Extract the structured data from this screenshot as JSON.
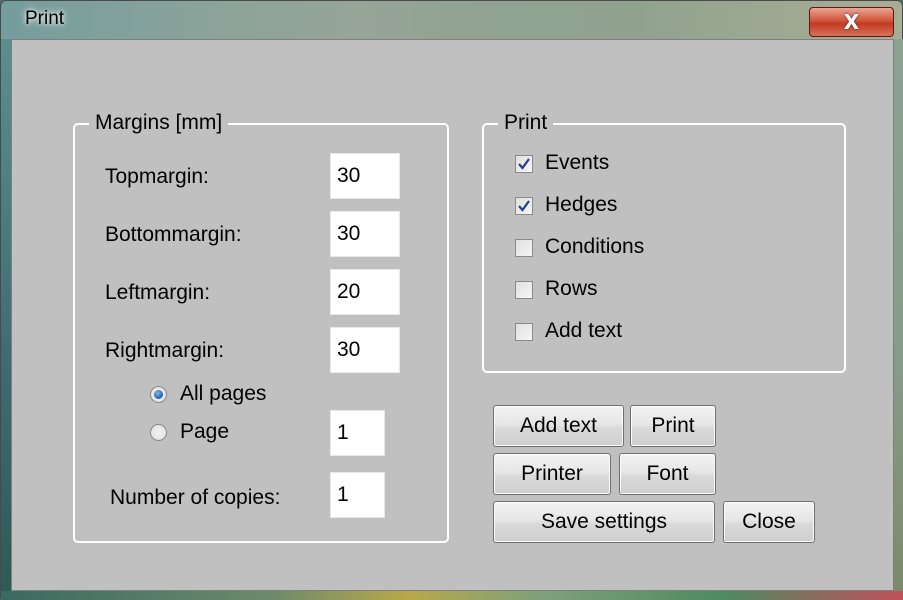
{
  "window": {
    "title": "Print",
    "close_glyph": "X"
  },
  "margins": {
    "legend": "Margins [mm]",
    "top_label": "Topmargin:",
    "top_value": "30",
    "bottom_label": "Bottommargin:",
    "bottom_value": "30",
    "left_label": "Leftmargin:",
    "left_value": "20",
    "right_label": "Rightmargin:",
    "right_value": "30",
    "all_pages_label": "All pages",
    "all_pages_selected": true,
    "page_label": "Page",
    "page_selected": false,
    "page_value": "1",
    "copies_label": "Number of copies:",
    "copies_value": "1"
  },
  "print_options": {
    "legend": "Print",
    "items": [
      {
        "label": "Events",
        "checked": true
      },
      {
        "label": "Hedges",
        "checked": true
      },
      {
        "label": "Conditions",
        "checked": false
      },
      {
        "label": "Rows",
        "checked": false
      },
      {
        "label": "Add text",
        "checked": false
      }
    ]
  },
  "buttons": {
    "add_text": "Add text",
    "print": "Print",
    "printer": "Printer",
    "font": "Font",
    "save_settings": "Save settings",
    "close": "Close"
  },
  "colors": {
    "dialog_bg": "#c0c0c0",
    "check_mark": "#1f3f8f",
    "radio_dot": "#1c5fa8",
    "close_button": "#c23a22"
  }
}
